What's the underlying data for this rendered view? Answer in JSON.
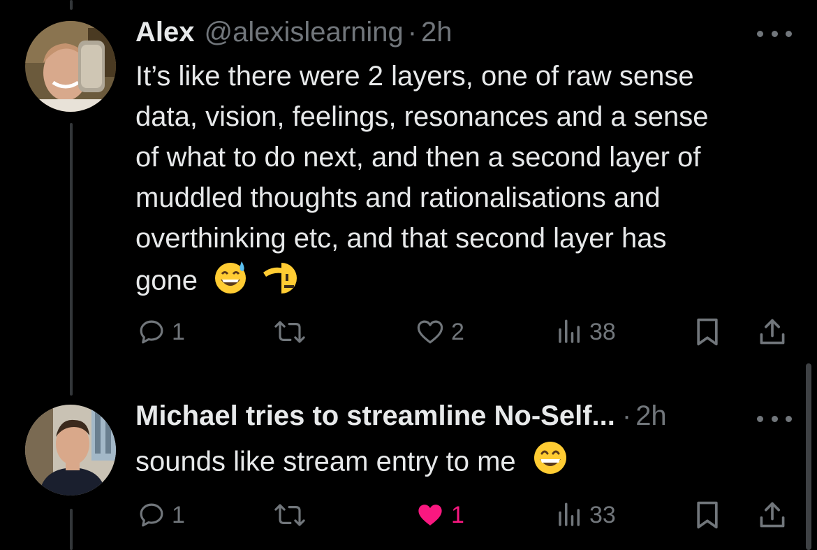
{
  "colors": {
    "background": "#000000",
    "text_primary": "#e7e9ea",
    "text_secondary": "#71767b",
    "like_active": "#f91880"
  },
  "tweets": [
    {
      "author_name": "Alex",
      "handle": "@alexislearning",
      "separator": "·",
      "time": "2h",
      "text_lines": [
        "It’s like there were 2 layers, one of raw sense",
        "data, vision, feelings, resonances and a sense",
        "of what to do next, and then a second layer of",
        "muddled thoughts and rationalisations and",
        "overthinking etc, and that second layer has",
        "gone"
      ],
      "emojis": [
        "grinning-face-with-sweat-icon",
        "saluting-face-icon"
      ],
      "replies": "1",
      "retweets": "",
      "likes": "2",
      "liked": false,
      "views": "38"
    },
    {
      "author_name": "Michael tries to streamline No-Self...",
      "separator": "·",
      "time": "2h",
      "text_lines": [
        "sounds like stream entry to me"
      ],
      "emojis": [
        "beaming-face-icon"
      ],
      "replies": "1",
      "retweets": "",
      "likes": "1",
      "liked": true,
      "views": "33"
    }
  ]
}
